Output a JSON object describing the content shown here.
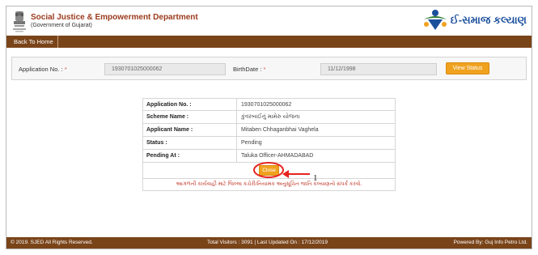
{
  "header": {
    "title": "Social Justice & Empowerment Department",
    "subtitle": "(Government of Gujarat)",
    "logo_text": "ઈ-સમાજ કલ્યાણ",
    "brand_color": "#9b3a1c",
    "logo_color": "#1a4f9c"
  },
  "nav": {
    "home_label": "Back To Home"
  },
  "search": {
    "app_no_label": "Application No. :",
    "app_no_value": "1930701025000062",
    "birthdate_label": "BirthDate :",
    "birthdate_value": "11/12/1998",
    "required_mark": "*",
    "view_status_label": "View Status"
  },
  "result": {
    "rows": [
      {
        "key": "Application No. :",
        "value": "1930701025000062"
      },
      {
        "key": "Scheme Name :",
        "value": "કુંવરબાઈનું મામેરુ યોજના"
      },
      {
        "key": "Applicant Name :",
        "value": "Mitaben Chhaganbhai Vaghela"
      },
      {
        "key": "Status :",
        "value": "Pending"
      },
      {
        "key": "Pending At :",
        "value": "Taluka Officer-AHMADABAD"
      }
    ],
    "close_label": "Close",
    "note": "આગળની કાર્યવાહી માટે જિલ્લા કચેરી/નિયામક અનુસૂચિત જાતિ કલ્યાણનો સંપર્ક કરવો."
  },
  "annotation": {
    "number": "1",
    "color": "#e8231f"
  },
  "footer": {
    "copyright": "© 2019. SJED All Rights Reserved.",
    "visitors": "Total Visitors : 3091 | Last Updated On : 17/12/2019",
    "powered": "Powered By: Guj Info Petro Ltd."
  }
}
